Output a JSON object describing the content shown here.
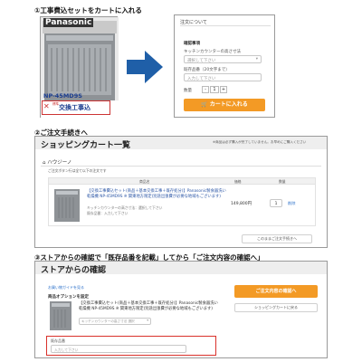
{
  "step1": {
    "title": "①工事費込セットをカートに入れる",
    "product": {
      "brand": "Panasonic",
      "model": "NP-45MD9S",
      "badge_small": "標準",
      "badge_big": "交換工事込"
    },
    "order_panel": {
      "header": "注文について",
      "section_title": "確認事項",
      "select_label": "キッチンカウンターの高さ寸法",
      "select_value": "選択して下さい",
      "existing_label": "既存品番（20文字まで）",
      "existing_placeholder": "入力して下さい",
      "qty_label": "数量",
      "qty_minus": "-",
      "qty_value": "1",
      "qty_plus": "+",
      "cart_button": "カートに入れる"
    }
  },
  "step2": {
    "title": "②ご注文手続きへ",
    "heading": "ショッピングカート一覧",
    "notice": "※商品は必ず購入が完了していません。お早めにご購入ください",
    "store_name": "ハウジーノ",
    "store_note": "ご注文ボタン行は全て以下の注文です",
    "table_headers": {
      "product": "商品名",
      "price": "価格",
      "qty": "数量"
    },
    "item": {
      "name": "【交換工事費込セット(商品＋基本交換工事＋既存処分)】Panasonic製食器洗い乾燥機 NP-45MD9S ※ 関東地方限定(別途出張費が必要な地域もございます)",
      "option_line1": "キッチンカウンターの高さ寸法：選択して下さい",
      "option_line2": "既存品番：入力して下さい",
      "price": "149,800円",
      "qty": "1",
      "delete": "削除"
    },
    "next_button": "このままご注文手続きへ"
  },
  "step3": {
    "title": "③ストアからの確認で「既存品番を記載」してから「ご注文内容の確認へ」",
    "heading": "ストアからの確認",
    "guide_link": "お買い物ガイドを見る",
    "option_title": "商品オプションを設定",
    "item_name": "【交換工事費込セット(商品＋基本交換工事＋既存処分)】Panasonic製食器洗い乾燥機 NP-45MD9S ※ 関東地方限定(別途出張費が必要な地域もございます)",
    "select_value": "キッチンカウンターの高さ寸法 選択",
    "existing_label": "既存品番",
    "existing_placeholder": "入力して下さい",
    "confirm_button": "ご注文内容の確認へ",
    "back_button": "ショッピングカートに戻る"
  },
  "icons": {
    "arrow": "right-arrow-icon",
    "cart": "cart-icon",
    "house": "house-icon"
  },
  "colors": {
    "accent_orange": "#f39a25",
    "arrow_blue": "#1f5fa8",
    "highlight_red": "#d9312b"
  }
}
